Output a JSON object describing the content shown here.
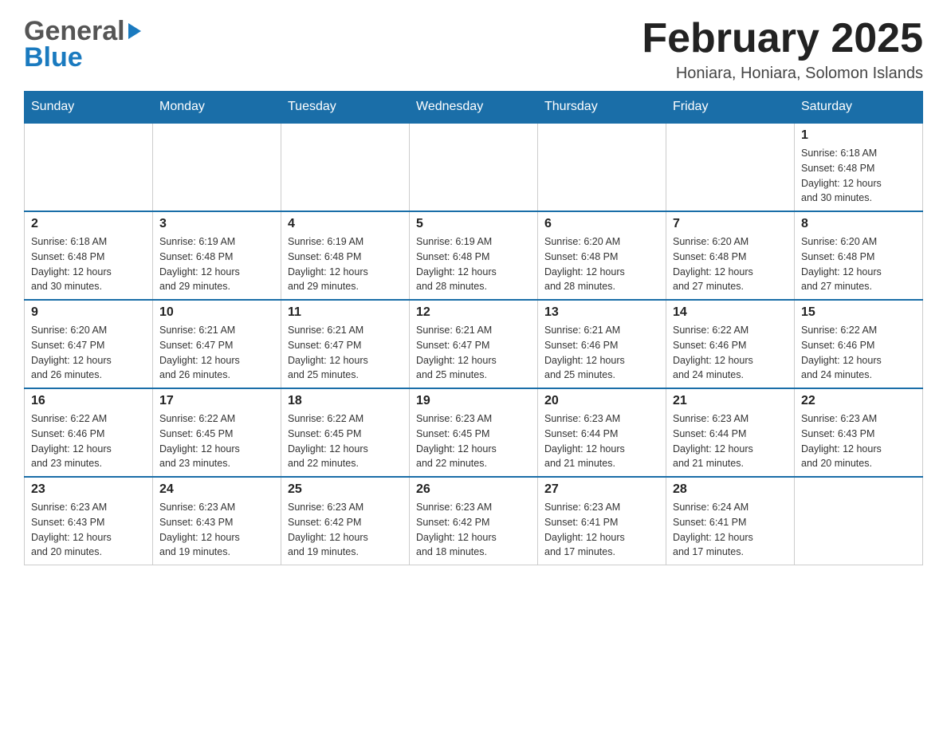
{
  "header": {
    "logo_line1": "General",
    "logo_line2": "Blue",
    "month_title": "February 2025",
    "location": "Honiara, Honiara, Solomon Islands"
  },
  "weekdays": [
    "Sunday",
    "Monday",
    "Tuesday",
    "Wednesday",
    "Thursday",
    "Friday",
    "Saturday"
  ],
  "weeks": [
    {
      "days": [
        {
          "number": "",
          "info": ""
        },
        {
          "number": "",
          "info": ""
        },
        {
          "number": "",
          "info": ""
        },
        {
          "number": "",
          "info": ""
        },
        {
          "number": "",
          "info": ""
        },
        {
          "number": "",
          "info": ""
        },
        {
          "number": "1",
          "info": "Sunrise: 6:18 AM\nSunset: 6:48 PM\nDaylight: 12 hours\nand 30 minutes."
        }
      ]
    },
    {
      "days": [
        {
          "number": "2",
          "info": "Sunrise: 6:18 AM\nSunset: 6:48 PM\nDaylight: 12 hours\nand 30 minutes."
        },
        {
          "number": "3",
          "info": "Sunrise: 6:19 AM\nSunset: 6:48 PM\nDaylight: 12 hours\nand 29 minutes."
        },
        {
          "number": "4",
          "info": "Sunrise: 6:19 AM\nSunset: 6:48 PM\nDaylight: 12 hours\nand 29 minutes."
        },
        {
          "number": "5",
          "info": "Sunrise: 6:19 AM\nSunset: 6:48 PM\nDaylight: 12 hours\nand 28 minutes."
        },
        {
          "number": "6",
          "info": "Sunrise: 6:20 AM\nSunset: 6:48 PM\nDaylight: 12 hours\nand 28 minutes."
        },
        {
          "number": "7",
          "info": "Sunrise: 6:20 AM\nSunset: 6:48 PM\nDaylight: 12 hours\nand 27 minutes."
        },
        {
          "number": "8",
          "info": "Sunrise: 6:20 AM\nSunset: 6:48 PM\nDaylight: 12 hours\nand 27 minutes."
        }
      ]
    },
    {
      "days": [
        {
          "number": "9",
          "info": "Sunrise: 6:20 AM\nSunset: 6:47 PM\nDaylight: 12 hours\nand 26 minutes."
        },
        {
          "number": "10",
          "info": "Sunrise: 6:21 AM\nSunset: 6:47 PM\nDaylight: 12 hours\nand 26 minutes."
        },
        {
          "number": "11",
          "info": "Sunrise: 6:21 AM\nSunset: 6:47 PM\nDaylight: 12 hours\nand 25 minutes."
        },
        {
          "number": "12",
          "info": "Sunrise: 6:21 AM\nSunset: 6:47 PM\nDaylight: 12 hours\nand 25 minutes."
        },
        {
          "number": "13",
          "info": "Sunrise: 6:21 AM\nSunset: 6:46 PM\nDaylight: 12 hours\nand 25 minutes."
        },
        {
          "number": "14",
          "info": "Sunrise: 6:22 AM\nSunset: 6:46 PM\nDaylight: 12 hours\nand 24 minutes."
        },
        {
          "number": "15",
          "info": "Sunrise: 6:22 AM\nSunset: 6:46 PM\nDaylight: 12 hours\nand 24 minutes."
        }
      ]
    },
    {
      "days": [
        {
          "number": "16",
          "info": "Sunrise: 6:22 AM\nSunset: 6:46 PM\nDaylight: 12 hours\nand 23 minutes."
        },
        {
          "number": "17",
          "info": "Sunrise: 6:22 AM\nSunset: 6:45 PM\nDaylight: 12 hours\nand 23 minutes."
        },
        {
          "number": "18",
          "info": "Sunrise: 6:22 AM\nSunset: 6:45 PM\nDaylight: 12 hours\nand 22 minutes."
        },
        {
          "number": "19",
          "info": "Sunrise: 6:23 AM\nSunset: 6:45 PM\nDaylight: 12 hours\nand 22 minutes."
        },
        {
          "number": "20",
          "info": "Sunrise: 6:23 AM\nSunset: 6:44 PM\nDaylight: 12 hours\nand 21 minutes."
        },
        {
          "number": "21",
          "info": "Sunrise: 6:23 AM\nSunset: 6:44 PM\nDaylight: 12 hours\nand 21 minutes."
        },
        {
          "number": "22",
          "info": "Sunrise: 6:23 AM\nSunset: 6:43 PM\nDaylight: 12 hours\nand 20 minutes."
        }
      ]
    },
    {
      "days": [
        {
          "number": "23",
          "info": "Sunrise: 6:23 AM\nSunset: 6:43 PM\nDaylight: 12 hours\nand 20 minutes."
        },
        {
          "number": "24",
          "info": "Sunrise: 6:23 AM\nSunset: 6:43 PM\nDaylight: 12 hours\nand 19 minutes."
        },
        {
          "number": "25",
          "info": "Sunrise: 6:23 AM\nSunset: 6:42 PM\nDaylight: 12 hours\nand 19 minutes."
        },
        {
          "number": "26",
          "info": "Sunrise: 6:23 AM\nSunset: 6:42 PM\nDaylight: 12 hours\nand 18 minutes."
        },
        {
          "number": "27",
          "info": "Sunrise: 6:23 AM\nSunset: 6:41 PM\nDaylight: 12 hours\nand 17 minutes."
        },
        {
          "number": "28",
          "info": "Sunrise: 6:24 AM\nSunset: 6:41 PM\nDaylight: 12 hours\nand 17 minutes."
        },
        {
          "number": "",
          "info": ""
        }
      ]
    }
  ]
}
